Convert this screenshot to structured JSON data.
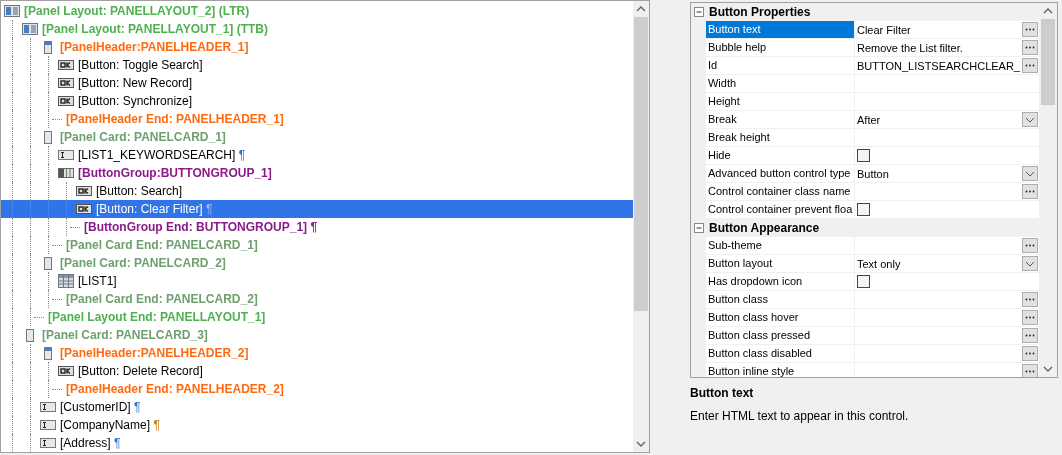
{
  "tree": [
    {
      "kind": "layout",
      "label": "[Panel Layout: PANELLAYOUT_2] (LTR)",
      "selected": false,
      "children": [
        {
          "kind": "layout",
          "label": "[Panel Layout: PANELLAYOUT_1] (TTB)",
          "selected": false,
          "children": [
            {
              "kind": "header",
              "label": "[PanelHeader:PANELHEADER_1]",
              "selected": false,
              "children": [
                {
                  "kind": "button",
                  "label": "[Button: Toggle Search]",
                  "selected": false
                },
                {
                  "kind": "button",
                  "label": "[Button: New Record]",
                  "selected": false
                },
                {
                  "kind": "button",
                  "label": "[Button: Synchronize]",
                  "selected": false
                },
                {
                  "kind": "header-end",
                  "label": "[PanelHeader End: PANELHEADER_1]",
                  "selected": false
                }
              ]
            },
            {
              "kind": "card",
              "label": "[Panel Card: PANELCARD_1]",
              "selected": false,
              "children": [
                {
                  "kind": "field",
                  "label": "[LIST1_KEYWORDSEARCH]",
                  "pilcrow": "¶",
                  "color": "#2f6fd0",
                  "selected": false
                },
                {
                  "kind": "group",
                  "label": "[ButtonGroup:BUTTONGROUP_1]",
                  "selected": false,
                  "children": [
                    {
                      "kind": "button",
                      "label": "[Button: Search]",
                      "selected": false
                    },
                    {
                      "kind": "button",
                      "label": "[Button: Clear Filter]",
                      "pilcrow": "¶",
                      "color": "#9fb8ff",
                      "selected": true
                    },
                    {
                      "kind": "group-end",
                      "label": "[ButtonGroup End: BUTTONGROUP_1]",
                      "pilcrow": "¶",
                      "color": "#8a2a9a",
                      "selected": false
                    }
                  ]
                },
                {
                  "kind": "card-end",
                  "label": "[Panel Card End: PANELCARD_1]",
                  "selected": false
                }
              ]
            },
            {
              "kind": "card",
              "label": "[Panel Card: PANELCARD_2]",
              "selected": false,
              "children": [
                {
                  "kind": "list",
                  "label": "[LIST1]",
                  "selected": false
                },
                {
                  "kind": "card-end",
                  "label": "[Panel Card End: PANELCARD_2]",
                  "selected": false
                }
              ]
            },
            {
              "kind": "layout-end",
              "label": "[Panel Layout End: PANELLAYOUT_1]",
              "selected": false
            }
          ]
        },
        {
          "kind": "card",
          "label": "[Panel Card: PANELCARD_3]",
          "selected": false,
          "children": [
            {
              "kind": "header",
              "label": "[PanelHeader:PANELHEADER_2]",
              "selected": false,
              "children": [
                {
                  "kind": "button",
                  "label": "[Button: Delete Record]",
                  "selected": false
                },
                {
                  "kind": "header-end",
                  "label": "[PanelHeader End: PANELHEADER_2]",
                  "selected": false
                }
              ]
            },
            {
              "kind": "field",
              "label": "[CustomerID]",
              "pilcrow": "¶",
              "color": "#2f6fd0",
              "selected": false
            },
            {
              "kind": "field",
              "label": "[CompanyName]",
              "pilcrow": "¶",
              "color": "#c07a10",
              "selected": false
            },
            {
              "kind": "field",
              "label": "[Address]",
              "pilcrow": "¶",
              "color": "#2f6fd0",
              "selected": false
            }
          ]
        }
      ]
    }
  ],
  "properties": [
    {
      "title": "Button Properties",
      "expanded": true,
      "rows": [
        {
          "name": "Button text",
          "value": "Clear Filter",
          "kind": "ellipsis",
          "selected": true
        },
        {
          "name": "Bubble help",
          "value": "Remove the List filter.",
          "kind": "ellipsis",
          "selected": false
        },
        {
          "name": "Id",
          "value": "BUTTON_LISTSEARCHCLEAR_",
          "kind": "ellipsis",
          "selected": false
        },
        {
          "name": "Width",
          "kind": "plain",
          "selected": false
        },
        {
          "name": "Height",
          "kind": "plain",
          "selected": false
        },
        {
          "name": "Break",
          "value": "After",
          "kind": "dropdown",
          "selected": false
        },
        {
          "name": "Break height",
          "kind": "plain",
          "selected": false
        },
        {
          "name": "Hide",
          "kind": "checkbox",
          "checked": false,
          "selected": false
        },
        {
          "name": "Advanced button control type",
          "value": "Button",
          "kind": "dropdown",
          "selected": false
        },
        {
          "name": "Control container class name",
          "kind": "ellipsis",
          "selected": false
        },
        {
          "name": "Control container prevent floa",
          "kind": "checkbox",
          "checked": false,
          "selected": false
        }
      ]
    },
    {
      "title": "Button Appearance",
      "expanded": true,
      "rows": [
        {
          "name": "Sub-theme",
          "kind": "ellipsis",
          "selected": false
        },
        {
          "name": "Button layout",
          "value": "Text only",
          "kind": "dropdown",
          "selected": false
        },
        {
          "name": "Has dropdown icon",
          "kind": "checkbox",
          "checked": false,
          "selected": false
        },
        {
          "name": "Button class",
          "kind": "ellipsis",
          "selected": false
        },
        {
          "name": "Button class hover",
          "kind": "ellipsis",
          "selected": false
        },
        {
          "name": "Button class pressed",
          "kind": "ellipsis",
          "selected": false
        },
        {
          "name": "Button class disabled",
          "kind": "ellipsis",
          "selected": false
        },
        {
          "name": "Button inline style",
          "kind": "ellipsis",
          "selected": false
        }
      ]
    }
  ],
  "help": {
    "title": "Button text",
    "text": "Enter HTML text to appear in this control."
  }
}
